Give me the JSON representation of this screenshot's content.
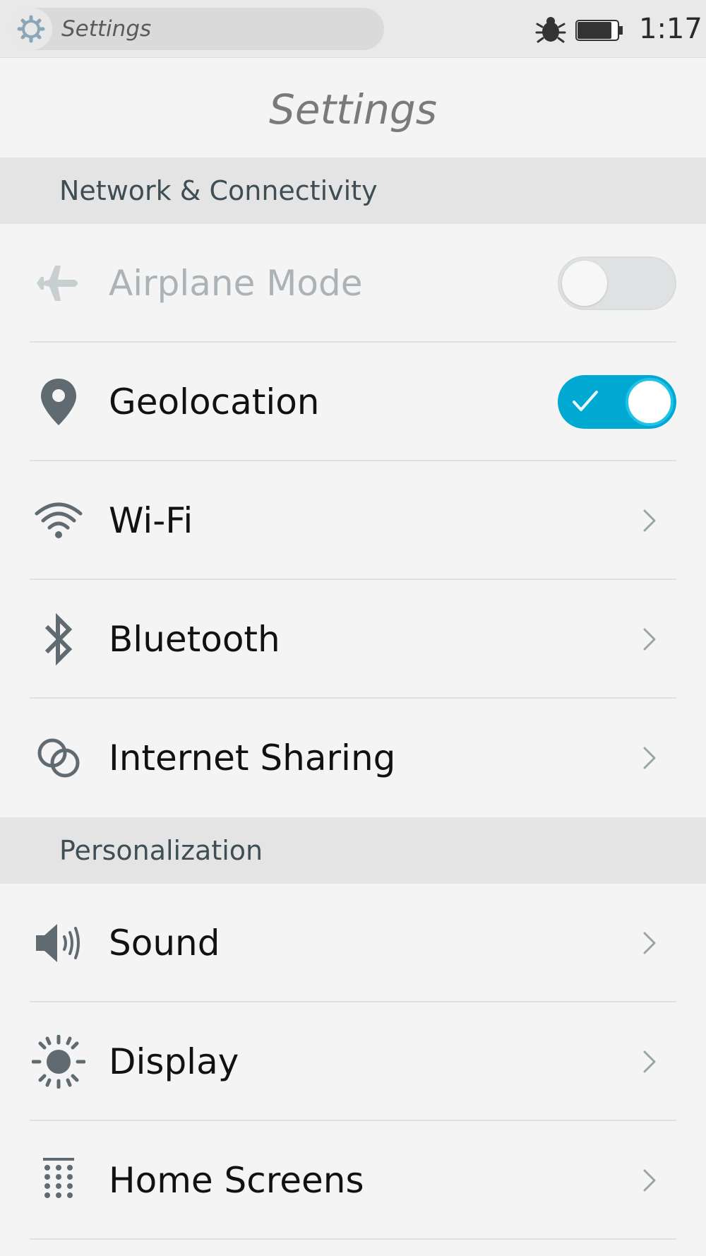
{
  "status_bar": {
    "app_name": "Settings",
    "time": "1:17"
  },
  "header": {
    "title": "Settings"
  },
  "sections": [
    {
      "title": "Network & Connectivity",
      "items": [
        {
          "label": "Airplane Mode",
          "icon": "airplane-icon",
          "control": "toggle",
          "state": "off",
          "disabled": true
        },
        {
          "label": "Geolocation",
          "icon": "location-pin-icon",
          "control": "toggle",
          "state": "on"
        },
        {
          "label": "Wi-Fi",
          "icon": "wifi-icon",
          "control": "chevron"
        },
        {
          "label": "Bluetooth",
          "icon": "bluetooth-icon",
          "control": "chevron"
        },
        {
          "label": "Internet Sharing",
          "icon": "internet-sharing-icon",
          "control": "chevron"
        }
      ]
    },
    {
      "title": "Personalization",
      "items": [
        {
          "label": "Sound",
          "icon": "speaker-icon",
          "control": "chevron"
        },
        {
          "label": "Display",
          "icon": "sun-icon",
          "control": "chevron"
        },
        {
          "label": "Home Screens",
          "icon": "grid-dots-icon",
          "control": "chevron"
        }
      ]
    }
  ],
  "colors": {
    "accent": "#00a9d2",
    "icon": "#5f6b70",
    "section_bg": "#e4e4e4",
    "page_bg": "#f4f4f4"
  }
}
